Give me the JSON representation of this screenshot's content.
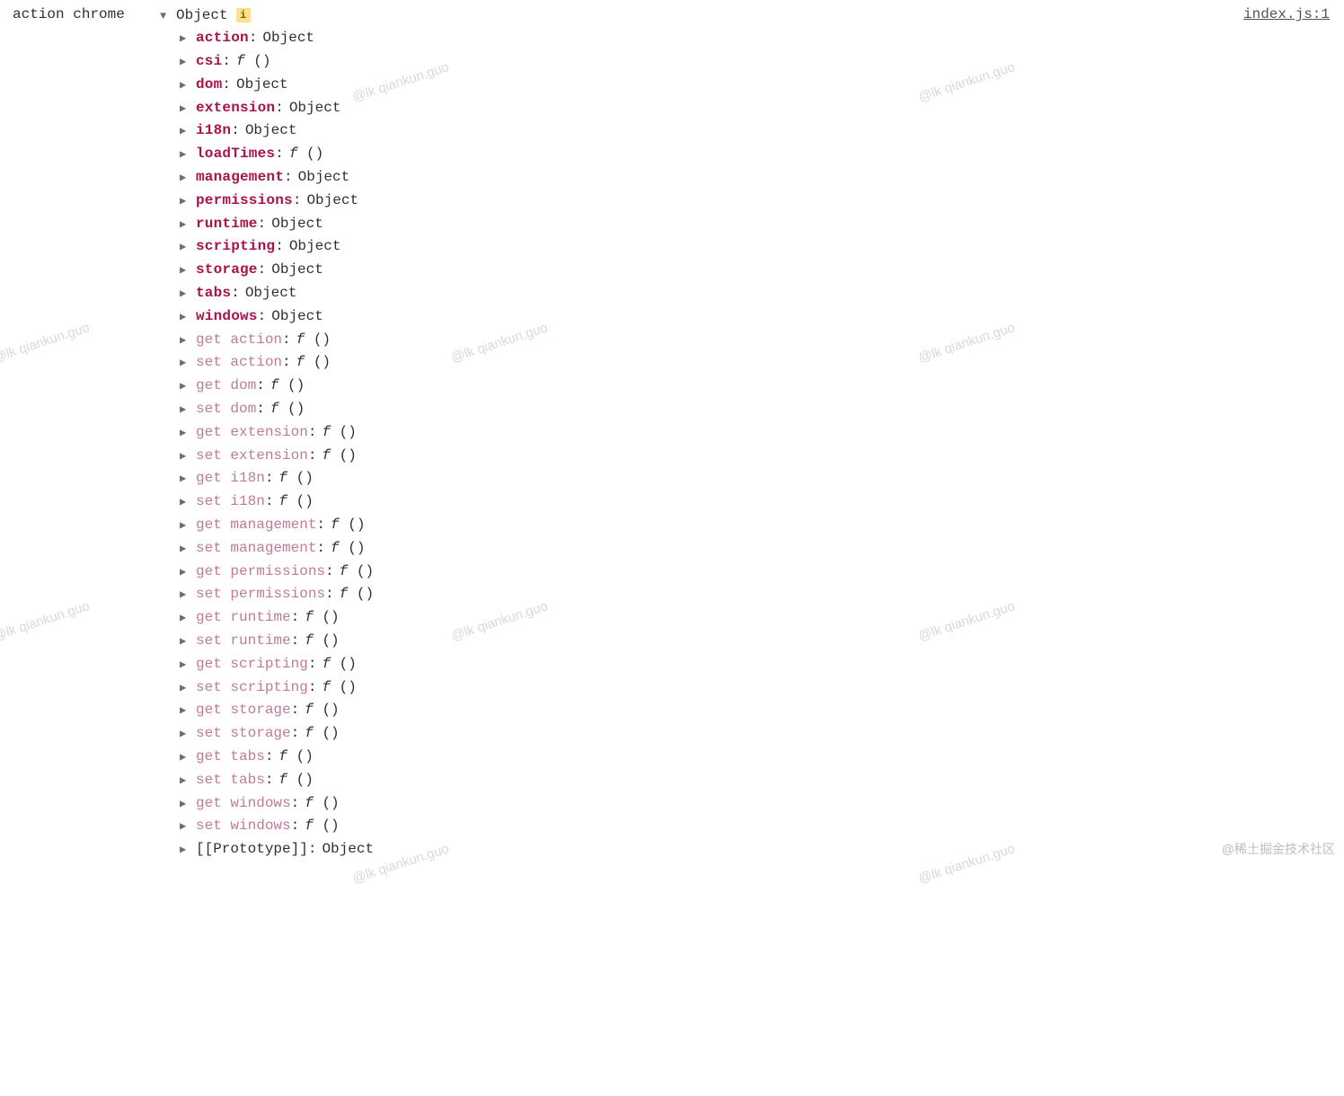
{
  "log_prefix": "action chrome",
  "source_link": "index.js:1",
  "root_toggle_label": "Object",
  "info_badge": "i",
  "properties": [
    {
      "style": "bold",
      "key": "action",
      "valueType": "object",
      "valueText": "Object"
    },
    {
      "style": "bold",
      "key": "csi",
      "valueType": "func",
      "valueText": "f ()"
    },
    {
      "style": "bold",
      "key": "dom",
      "valueType": "object",
      "valueText": "Object"
    },
    {
      "style": "bold",
      "key": "extension",
      "valueType": "object",
      "valueText": "Object"
    },
    {
      "style": "bold",
      "key": "i18n",
      "valueType": "object",
      "valueText": "Object"
    },
    {
      "style": "bold",
      "key": "loadTimes",
      "valueType": "func",
      "valueText": "f ()"
    },
    {
      "style": "bold",
      "key": "management",
      "valueType": "object",
      "valueText": "Object"
    },
    {
      "style": "bold",
      "key": "permissions",
      "valueType": "object",
      "valueText": "Object"
    },
    {
      "style": "bold",
      "key": "runtime",
      "valueType": "object",
      "valueText": "Object"
    },
    {
      "style": "bold",
      "key": "scripting",
      "valueType": "object",
      "valueText": "Object"
    },
    {
      "style": "bold",
      "key": "storage",
      "valueType": "object",
      "valueText": "Object"
    },
    {
      "style": "bold",
      "key": "tabs",
      "valueType": "object",
      "valueText": "Object"
    },
    {
      "style": "bold",
      "key": "windows",
      "valueType": "object",
      "valueText": "Object"
    },
    {
      "style": "dim",
      "key": "get action",
      "valueType": "func",
      "valueText": "f ()"
    },
    {
      "style": "dim",
      "key": "set action",
      "valueType": "func",
      "valueText": "f ()"
    },
    {
      "style": "dim",
      "key": "get dom",
      "valueType": "func",
      "valueText": "f ()"
    },
    {
      "style": "dim",
      "key": "set dom",
      "valueType": "func",
      "valueText": "f ()"
    },
    {
      "style": "dim",
      "key": "get extension",
      "valueType": "func",
      "valueText": "f ()"
    },
    {
      "style": "dim",
      "key": "set extension",
      "valueType": "func",
      "valueText": "f ()"
    },
    {
      "style": "dim",
      "key": "get i18n",
      "valueType": "func",
      "valueText": "f ()"
    },
    {
      "style": "dim",
      "key": "set i18n",
      "valueType": "func",
      "valueText": "f ()"
    },
    {
      "style": "dim",
      "key": "get management",
      "valueType": "func",
      "valueText": "f ()"
    },
    {
      "style": "dim",
      "key": "set management",
      "valueType": "func",
      "valueText": "f ()"
    },
    {
      "style": "dim",
      "key": "get permissions",
      "valueType": "func",
      "valueText": "f ()"
    },
    {
      "style": "dim",
      "key": "set permissions",
      "valueType": "func",
      "valueText": "f ()"
    },
    {
      "style": "dim",
      "key": "get runtime",
      "valueType": "func",
      "valueText": "f ()"
    },
    {
      "style": "dim",
      "key": "set runtime",
      "valueType": "func",
      "valueText": "f ()"
    },
    {
      "style": "dim",
      "key": "get scripting",
      "valueType": "func",
      "valueText": "f ()"
    },
    {
      "style": "dim",
      "key": "set scripting",
      "valueType": "func",
      "valueText": "f ()"
    },
    {
      "style": "dim",
      "key": "get storage",
      "valueType": "func",
      "valueText": "f ()"
    },
    {
      "style": "dim",
      "key": "set storage",
      "valueType": "func",
      "valueText": "f ()"
    },
    {
      "style": "dim",
      "key": "get tabs",
      "valueType": "func",
      "valueText": "f ()"
    },
    {
      "style": "dim",
      "key": "set tabs",
      "valueType": "func",
      "valueText": "f ()"
    },
    {
      "style": "dim",
      "key": "get windows",
      "valueType": "func",
      "valueText": "f ()"
    },
    {
      "style": "dim",
      "key": "set windows",
      "valueType": "func",
      "valueText": "f ()"
    },
    {
      "style": "proto",
      "key": "[[Prototype]]",
      "valueType": "object",
      "valueText": "Object"
    }
  ],
  "watermark_text": "@lk qiankun.guo",
  "community_tag": "@稀土掘金技术社区"
}
